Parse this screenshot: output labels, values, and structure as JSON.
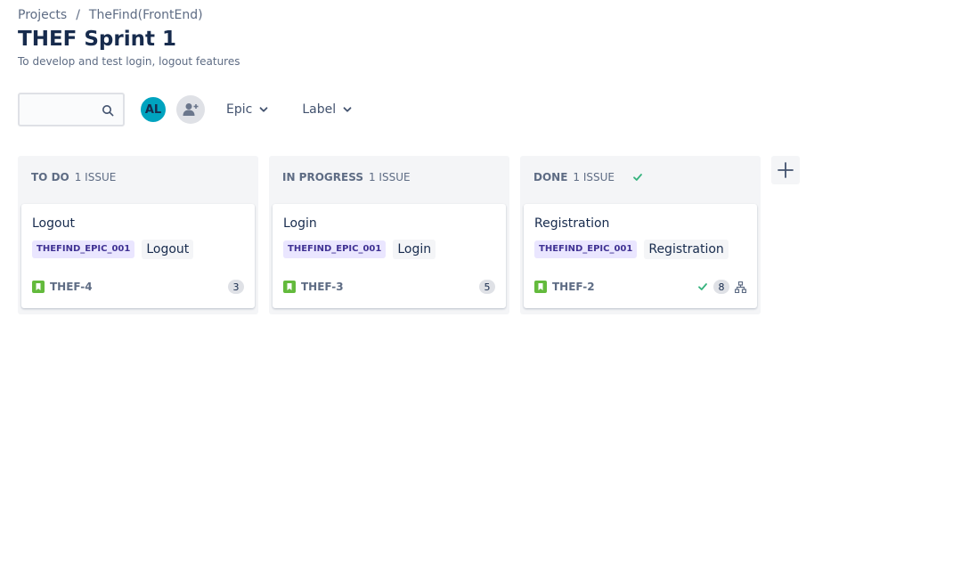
{
  "breadcrumb": {
    "projects": "Projects",
    "separator": "/",
    "project": "TheFind(FrontEnd)"
  },
  "page": {
    "title": "THEF Sprint 1",
    "subtitle": "To develop and test login, logout features"
  },
  "toolbar": {
    "search_placeholder": "",
    "avatar_initials": "AL",
    "epic_filter": "Epic",
    "label_filter": "Label"
  },
  "columns": [
    {
      "name": "TO DO",
      "count": "1 ISSUE",
      "card": {
        "title": "Logout",
        "epic": "THEFIND_EPIC_001",
        "label": "Logout",
        "key": "THEF-4",
        "estimate": "3"
      }
    },
    {
      "name": "IN PROGRESS",
      "count": "1 ISSUE",
      "card": {
        "title": "Login",
        "epic": "THEFIND_EPIC_001",
        "label": "Login",
        "key": "THEF-3",
        "estimate": "5"
      }
    },
    {
      "name": "DONE",
      "count": "1 ISSUE",
      "card": {
        "title": "Registration",
        "epic": "THEFIND_EPIC_001",
        "label": "Registration",
        "key": "THEF-2",
        "estimate": "8"
      }
    }
  ],
  "colors": {
    "avatar": "#00a3bf",
    "story_icon": "#63ba3c",
    "done_check": "#36b37e",
    "epic_bg": "#eae6ff",
    "epic_text": "#403294"
  },
  "icons": {
    "search": "search-icon",
    "add_people": "add-people-icon",
    "chevron": "chevron-down-icon",
    "story": "story-icon",
    "check": "check-icon",
    "subtasks": "subtasks-icon",
    "add": "plus-icon"
  }
}
